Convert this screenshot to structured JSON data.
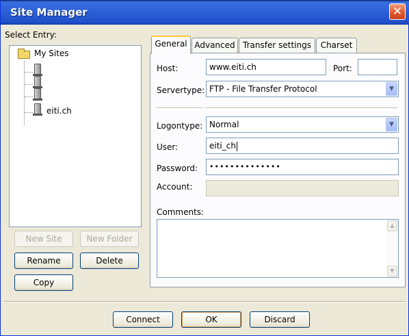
{
  "window": {
    "title": "Site Manager",
    "close_glyph": "✕"
  },
  "tree": {
    "label": "Select Entry:",
    "root_label": "My Sites",
    "selected_entry": "eiti.ch"
  },
  "left_buttons": {
    "new_site": "New Site",
    "new_folder": "New Folder",
    "rename": "Rename",
    "delete": "Delete",
    "copy": "Copy"
  },
  "tabs": [
    {
      "label": "General",
      "active": true
    },
    {
      "label": "Advanced",
      "active": false
    },
    {
      "label": "Transfer settings",
      "active": false
    },
    {
      "label": "Charset",
      "active": false
    }
  ],
  "general": {
    "host_label": "Host:",
    "host_value": "www.eiti.ch",
    "port_label": "Port:",
    "port_value": "",
    "servertype_label": "Servertype:",
    "servertype_value": "FTP - File Transfer Protocol",
    "logontype_label": "Logontype:",
    "logontype_value": "Normal",
    "user_label": "User:",
    "user_value": "eiti_ch",
    "password_label": "Password:",
    "password_value": "••••••••••••••",
    "account_label": "Account:",
    "account_value": "",
    "comments_label": "Comments:",
    "comments_value": ""
  },
  "footer_buttons": {
    "connect": "Connect",
    "ok": "OK",
    "discard": "Discard"
  },
  "icons": {
    "dropdown": "chevron-down-icon",
    "scroll_up": "▲",
    "scroll_down": "▼"
  },
  "colors": {
    "titlebar": "#2a5fd8",
    "close": "#e05a30",
    "tab_accent": "#ffc83c",
    "dialog_bg": "#ece9d8"
  }
}
